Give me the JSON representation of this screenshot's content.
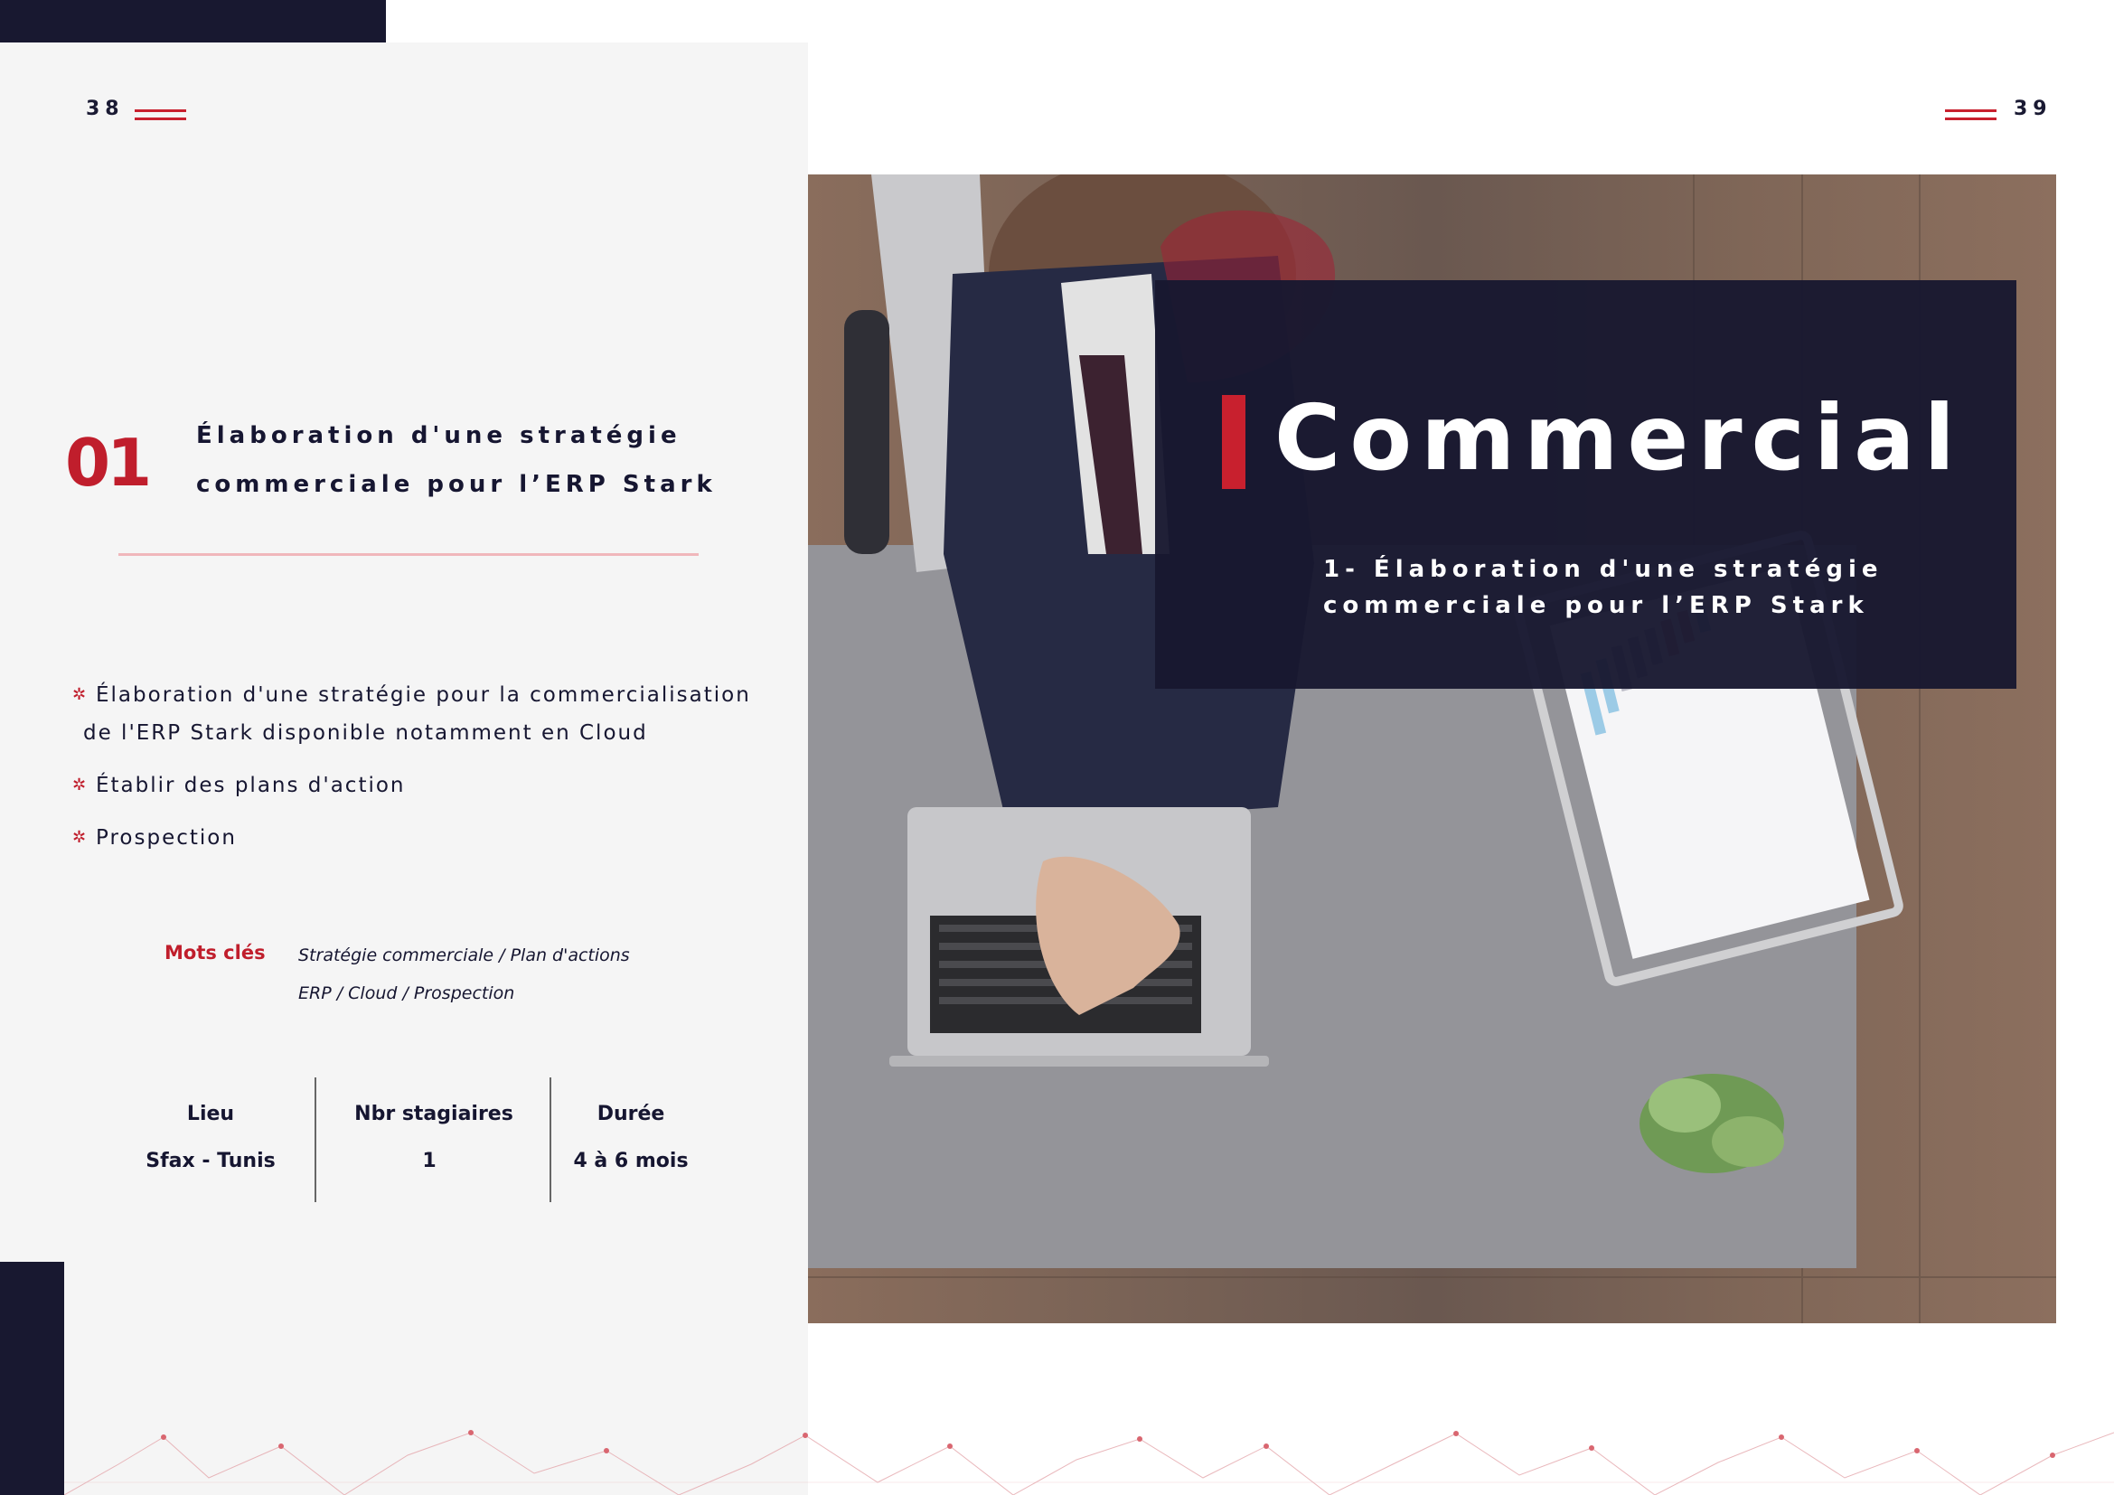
{
  "page_left": {
    "number": "38"
  },
  "page_right": {
    "number": "39"
  },
  "section": {
    "number": "01",
    "title_line1": "Élaboration d'une stratégie",
    "title_line2": "commerciale pour l’ERP Stark"
  },
  "bullets": {
    "b1_line1": "Élaboration d'une stratégie pour la commercialisation",
    "b1_line2": "de l'ERP Stark disponible notamment en Cloud",
    "b2": "Établir des plans d'action",
    "b3": "Prospection"
  },
  "keywords": {
    "label": "Mots clés",
    "line1": "Stratégie commerciale / Plan d'actions",
    "line2": "ERP / Cloud / Prospection"
  },
  "info": {
    "lieu_label": "Lieu",
    "lieu_value": "Sfax - Tunis",
    "stagiaires_label": "Nbr stagiaires",
    "stagiaires_value": "1",
    "duree_label": "Durée",
    "duree_value": "4 à 6 mois"
  },
  "banner": {
    "title": "Commercial",
    "subtitle_line1": "1- Élaboration d'une stratégie",
    "subtitle_line2": "commerciale pour l’ERP Stark"
  },
  "colors": {
    "navy": "#181830",
    "accent_red": "#c01e2c",
    "panel_gray": "#f5f5f5"
  }
}
